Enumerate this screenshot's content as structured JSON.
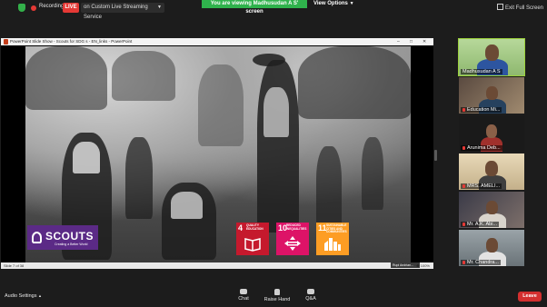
{
  "topbar": {
    "recording_label": "Recording",
    "live_label": "LIVE",
    "stream_label": "on Custom Live Streaming Service",
    "viewing_banner": "You are viewing Madhusudan A S' screen",
    "view_options_label": "View Options",
    "exit_fullscreen_label": "Exit Full Screen"
  },
  "ppt": {
    "window_title": "PowerPoint Slide Show - Scouts for SDG s - EN_links - PowerPoint",
    "status_left": "Slide 7 of 38",
    "status_right": "⊕ 100%",
    "presenter_name": "Rupi Andrian...",
    "scouts_logo": "SCOUTS",
    "scouts_tagline": "Creating a Better World",
    "sdg_cards": [
      {
        "number": "4",
        "label": "QUALITY EDUCATION",
        "color": "#c5192d"
      },
      {
        "number": "10",
        "label": "REDUCED INEQUALITIES",
        "color": "#dd1367"
      },
      {
        "number": "11",
        "label": "SUSTAINABLE CITIES AND COMMUNITIES",
        "color": "#fd9d24"
      }
    ]
  },
  "participants": [
    {
      "name": "Madhusudan A S",
      "muted": false,
      "active": true
    },
    {
      "name": "Education Mi...",
      "muted": true,
      "active": false
    },
    {
      "name": "Arunima Deb...",
      "muted": true,
      "active": false
    },
    {
      "name": "MRS. AMELI...",
      "muted": true,
      "active": false
    },
    {
      "name": "Mr. A.K. Abi...",
      "muted": true,
      "active": false
    },
    {
      "name": "Mr. Chandra...",
      "muted": true,
      "active": false
    }
  ],
  "bottombar": {
    "audio_settings_label": "Audio Settings",
    "chat_label": "Chat",
    "raise_hand_label": "Raise Hand",
    "qa_label": "Q&A",
    "leave_label": "Leave"
  },
  "colors": {
    "accent_green": "#2fb24c",
    "live_red": "#e53935",
    "leave_red": "#d32f2f",
    "scouts_purple": "#5b2a86"
  }
}
